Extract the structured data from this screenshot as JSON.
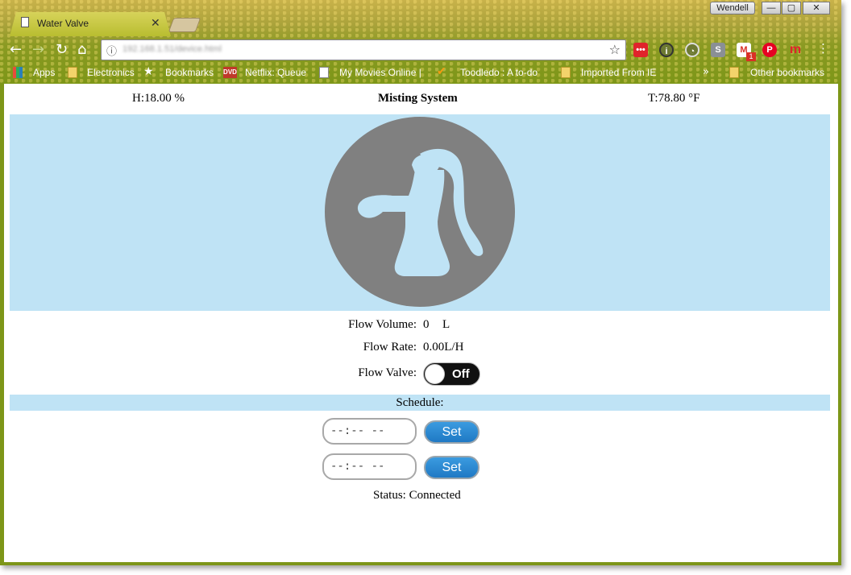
{
  "browser": {
    "tab_title": "Water Valve",
    "tab_close": "✕",
    "user_name": "Wendell",
    "window_controls": {
      "minimize": "—",
      "maximize": "▢",
      "close": "✕"
    },
    "url": "192.168.1.51/device.html",
    "bookmarks": {
      "apps": "Apps",
      "electronics": "Electronics",
      "bookmarks": "Bookmarks",
      "netflix": "Netflix: Queue",
      "movies": "My Movies Online |",
      "toodledo": "Toodledo : A to-do",
      "imported": "Imported From IE",
      "overflow": "»",
      "other": "Other bookmarks"
    },
    "dvd_label": "DVD",
    "gmail_badge": "1"
  },
  "page": {
    "humidity": "H:18.00 %",
    "title": "Misting System",
    "temperature": "T:78.80 °F",
    "flow_volume_label": "Flow Volume:",
    "flow_volume_value": "0",
    "flow_volume_unit": "L",
    "flow_rate_label": "Flow Rate:",
    "flow_rate_value": "0.00L/H",
    "flow_valve_label": "Flow Valve:",
    "flow_valve_state": "Off",
    "schedule_label": "Schedule:",
    "time_placeholder_1": "--:--  --",
    "time_placeholder_2": "--:--  --",
    "set_label_1": "Set",
    "set_label_2": "Set",
    "status": "Status: Connected"
  },
  "colors": {
    "hero_bg": "#bfe3f5",
    "pump_gray": "#808080",
    "set_blue": "#2a8ad6",
    "toggle_off": "#111111"
  }
}
